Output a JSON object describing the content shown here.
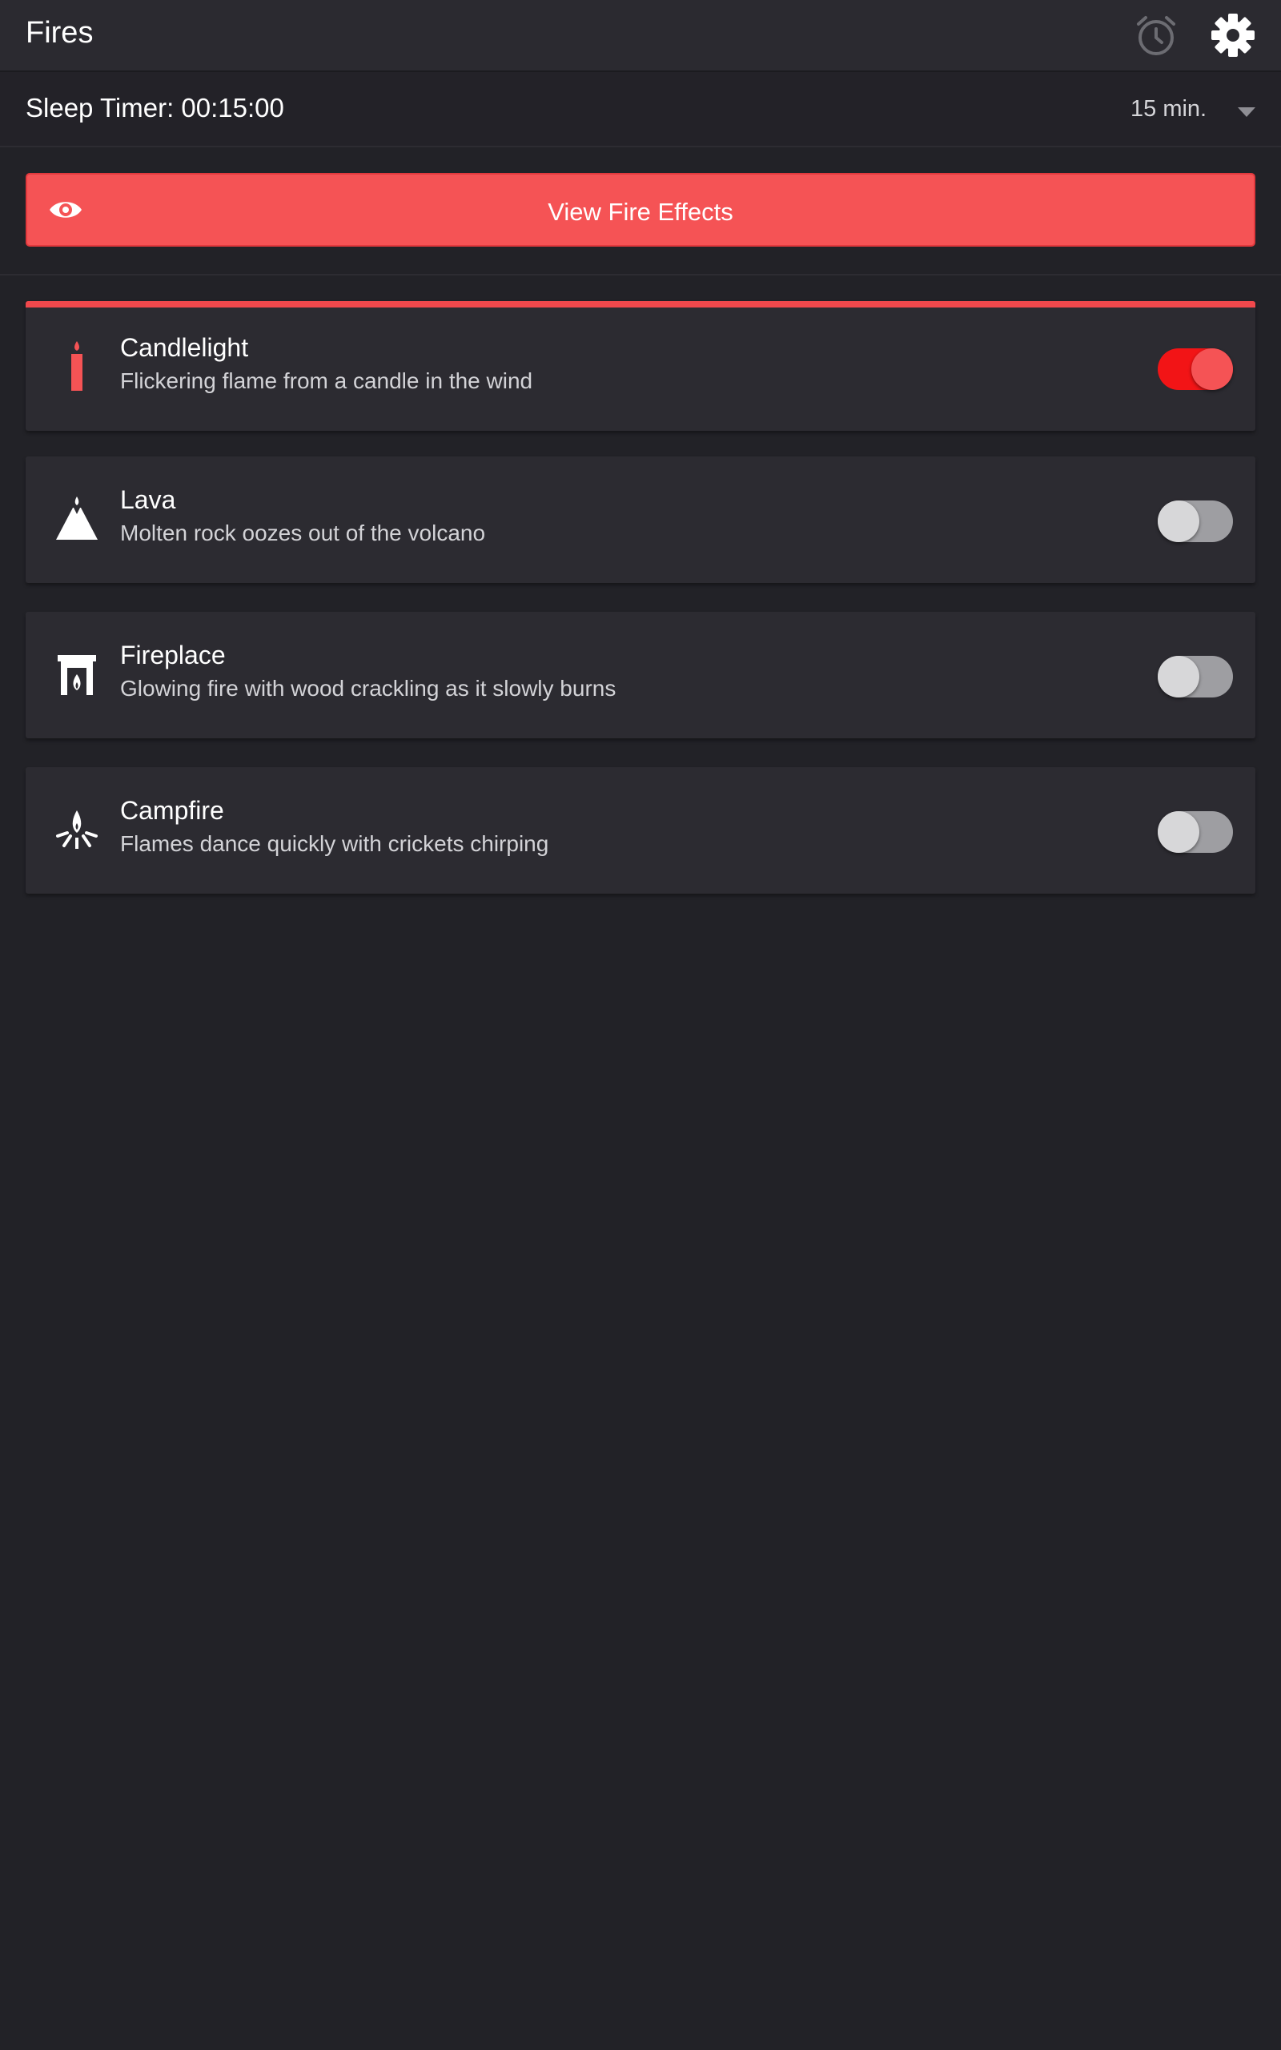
{
  "app": {
    "title": "Fires"
  },
  "header": {
    "alarm_icon": "alarm-clock-icon",
    "settings_icon": "gear-icon"
  },
  "sleep_timer": {
    "label": "Sleep Timer: 00:15:00",
    "selected_option": "15 min."
  },
  "effects_button": {
    "label": "View Fire Effects",
    "icon": "eye-icon"
  },
  "colors": {
    "accent": "#f55355",
    "toggle_on": "#f21416",
    "background": "#222227",
    "card": "#2c2b31"
  },
  "fires": [
    {
      "name": "Candlelight",
      "description": "Flickering flame from a candle in the wind",
      "icon": "candle-icon",
      "enabled": true
    },
    {
      "name": "Lava",
      "description": "Molten rock oozes out of the volcano",
      "icon": "volcano-icon",
      "enabled": false
    },
    {
      "name": "Fireplace",
      "description": "Glowing fire with wood crackling as it slowly burns",
      "icon": "fireplace-icon",
      "enabled": false
    },
    {
      "name": "Campfire",
      "description": "Flames dance quickly with crickets chirping",
      "icon": "campfire-icon",
      "enabled": false
    }
  ]
}
